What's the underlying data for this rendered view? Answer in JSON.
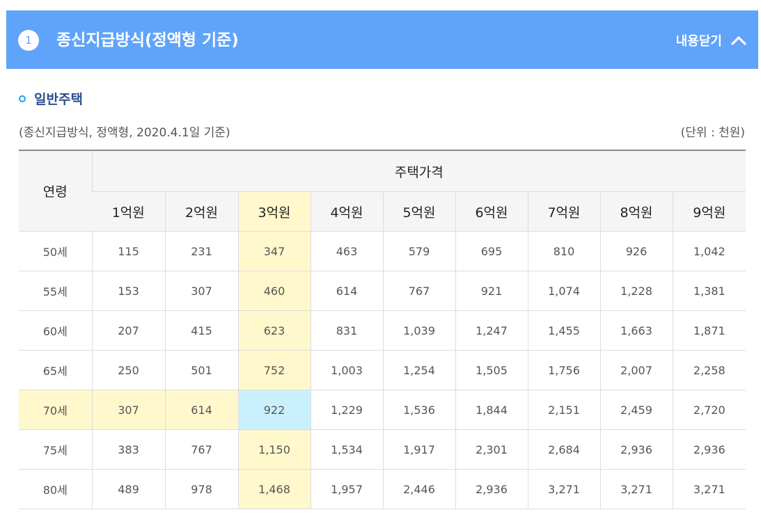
{
  "header": {
    "step_number": "1",
    "title": "종신지급방식(정액형 기준)",
    "toggle_label": "내용닫기",
    "toggle_icon": "chevron-up-icon",
    "background_color": "#5fa3fb"
  },
  "section": {
    "subtitle": "일반주택",
    "bullet_color": "#1ea3e6",
    "note": "(종신지급방식, 정액형, 2020.4.1일 기준)",
    "unit": "(단위 : 천원)"
  },
  "table": {
    "age_header": "연령",
    "price_header": "주택가격",
    "columns": [
      "1억원",
      "2억원",
      "3억원",
      "4억원",
      "5억원",
      "6억원",
      "7억원",
      "8억원",
      "9억원"
    ],
    "highlight_color": "#fff8cc",
    "focus_color": "#c8f1fd",
    "rows": [
      {
        "age": "50세",
        "values": [
          "115",
          "231",
          "347",
          "463",
          "579",
          "695",
          "810",
          "926",
          "1,042"
        ]
      },
      {
        "age": "55세",
        "values": [
          "153",
          "307",
          "460",
          "614",
          "767",
          "921",
          "1,074",
          "1,228",
          "1,381"
        ]
      },
      {
        "age": "60세",
        "values": [
          "207",
          "415",
          "623",
          "831",
          "1,039",
          "1,247",
          "1,455",
          "1,663",
          "1,871"
        ]
      },
      {
        "age": "65세",
        "values": [
          "250",
          "501",
          "752",
          "1,003",
          "1,254",
          "1,505",
          "1,756",
          "2,007",
          "2,258"
        ]
      },
      {
        "age": "70세",
        "values": [
          "307",
          "614",
          "922",
          "1,229",
          "1,536",
          "1,844",
          "2,151",
          "2,459",
          "2,720"
        ]
      },
      {
        "age": "75세",
        "values": [
          "383",
          "767",
          "1,150",
          "1,534",
          "1,917",
          "2,301",
          "2,684",
          "2,936",
          "2,936"
        ]
      },
      {
        "age": "80세",
        "values": [
          "489",
          "978",
          "1,468",
          "1,957",
          "2,446",
          "2,936",
          "3,271",
          "3,271",
          "3,271"
        ]
      }
    ]
  }
}
